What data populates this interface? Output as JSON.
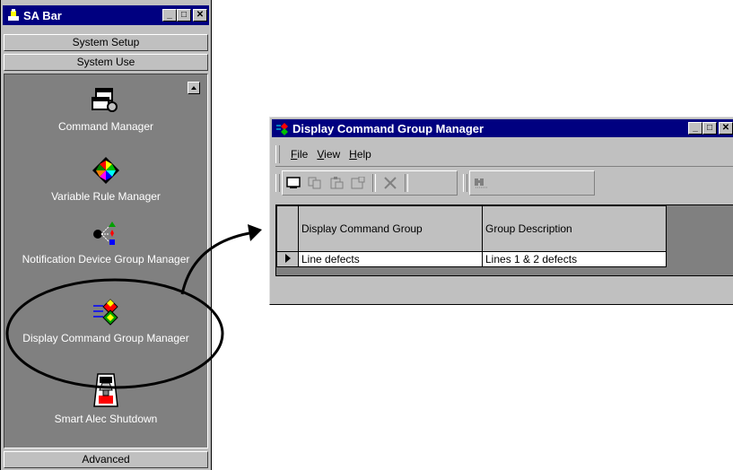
{
  "sa_bar": {
    "title": "SA Bar",
    "buttons": {
      "minimize": "_",
      "maximize": "□",
      "close": "✕"
    },
    "system_setup": "System Setup",
    "system_use": "System Use",
    "advanced": "Advanced",
    "tools": [
      {
        "label": "Command Manager",
        "icon": "command-manager-icon"
      },
      {
        "label": "Variable Rule Manager",
        "icon": "variable-rule-icon"
      },
      {
        "label": "Notification Device Group Manager",
        "icon": "notification-device-icon"
      },
      {
        "label": "Display Command Group Manager",
        "icon": "display-command-group-icon"
      },
      {
        "label": "Smart Alec Shutdown",
        "icon": "shutdown-switch-icon"
      }
    ]
  },
  "manager": {
    "title": "Display Command Group Manager",
    "buttons": {
      "minimize": "_",
      "maximize": "□",
      "close": "✕"
    },
    "menu": [
      {
        "label": "File",
        "underline": "F",
        "rest": "ile"
      },
      {
        "label": "View",
        "underline": "V",
        "rest": "iew"
      },
      {
        "label": "Help",
        "underline": "H",
        "rest": "elp"
      }
    ],
    "grid": {
      "columns": [
        "Display Command Group",
        "Group Description"
      ],
      "rows": [
        {
          "group": "Line defects",
          "description": "Lines 1 & 2 defects"
        }
      ]
    }
  },
  "colors": {
    "titlebar": "#000080",
    "face": "#c0c0c0",
    "panel": "#808080"
  }
}
